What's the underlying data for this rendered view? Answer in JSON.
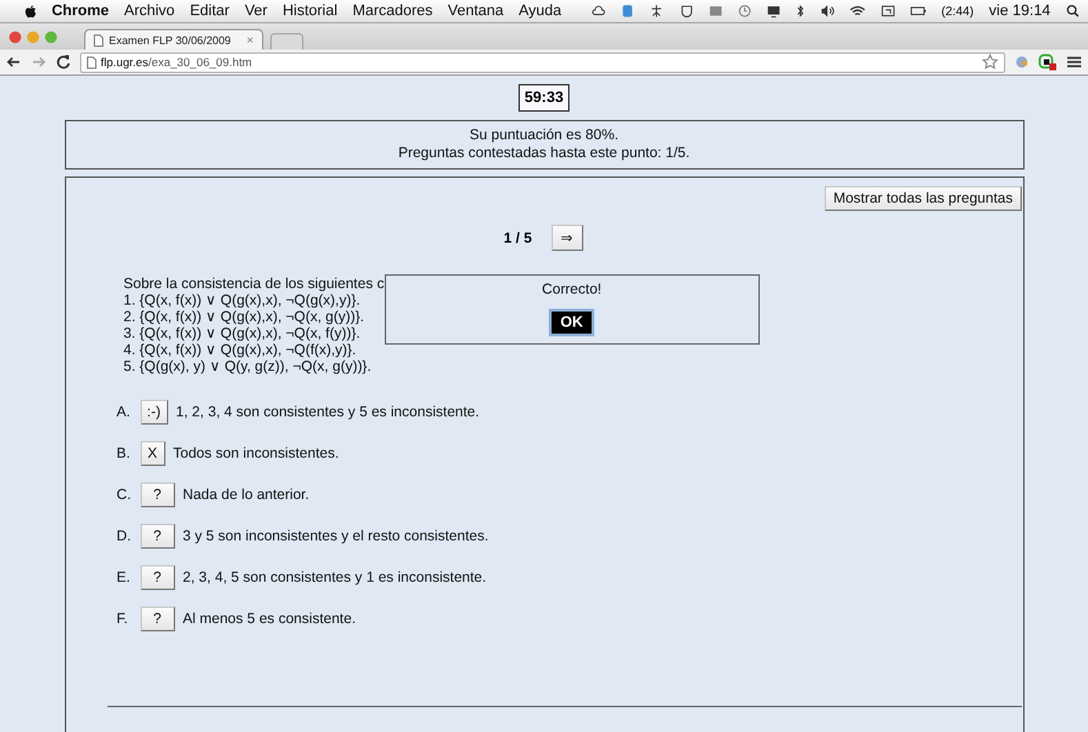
{
  "menubar": {
    "items": [
      {
        "label": "Chrome",
        "bold": true
      },
      {
        "label": "Archivo",
        "bold": false
      },
      {
        "label": "Editar",
        "bold": false
      },
      {
        "label": "Ver",
        "bold": false
      },
      {
        "label": "Historial",
        "bold": false
      },
      {
        "label": "Marcadores",
        "bold": false
      },
      {
        "label": "Ventana",
        "bold": false
      },
      {
        "label": "Ayuda",
        "bold": false
      }
    ],
    "battery": "(2:44)",
    "clock": "vie 19:14"
  },
  "tabs": [
    {
      "title": "Examen FLP 30/06/2009",
      "close": "×",
      "selected": true
    }
  ],
  "address": {
    "host": "flp.ugr.es",
    "path": "/exa_30_06_09.htm"
  },
  "timer": "59:33",
  "score": [
    "Su puntuación es 80%.",
    "Preguntas contestadas hasta este punto: 1/5."
  ],
  "show_all_button": "Mostrar todas las preguntas",
  "pager": {
    "position": "1 / 5",
    "next": "⇒"
  },
  "question": {
    "intro": "Sobre la consistencia de los siguientes c",
    "formulas": [
      "1. {Q(x, f(x)) ∨ Q(g(x),x), ¬Q(g(x),y)}.",
      "2. {Q(x, f(x)) ∨ Q(g(x),x), ¬Q(x, g(y))}.",
      "3. {Q(x, f(x)) ∨ Q(g(x),x), ¬Q(x, f(y))}.",
      "4. {Q(x, f(x)) ∨ Q(g(x),x), ¬Q(f(x),y)}.",
      "5. {Q(g(x), y) ∨ Q(y, g(z)), ¬Q(x, g(y))}."
    ]
  },
  "dialog": {
    "message": "Correcto!",
    "button": "OK"
  },
  "options": [
    {
      "letter": "A.",
      "mark": ":-)",
      "text": "1, 2, 3, 4 son consistentes y 5 es inconsistente."
    },
    {
      "letter": "B.",
      "mark": "X",
      "text": "Todos son inconsistentes."
    },
    {
      "letter": "C.",
      "mark": "?",
      "text": "Nada de lo anterior."
    },
    {
      "letter": "D.",
      "mark": "?",
      "text": "3 y 5 son inconsistentes y el resto consistentes."
    },
    {
      "letter": "E.",
      "mark": "?",
      "text": "2, 3, 4, 5 son consistentes y 1 es inconsistente."
    },
    {
      "letter": "F.",
      "mark": "?",
      "text": "Al menos 5 es consistente."
    }
  ]
}
